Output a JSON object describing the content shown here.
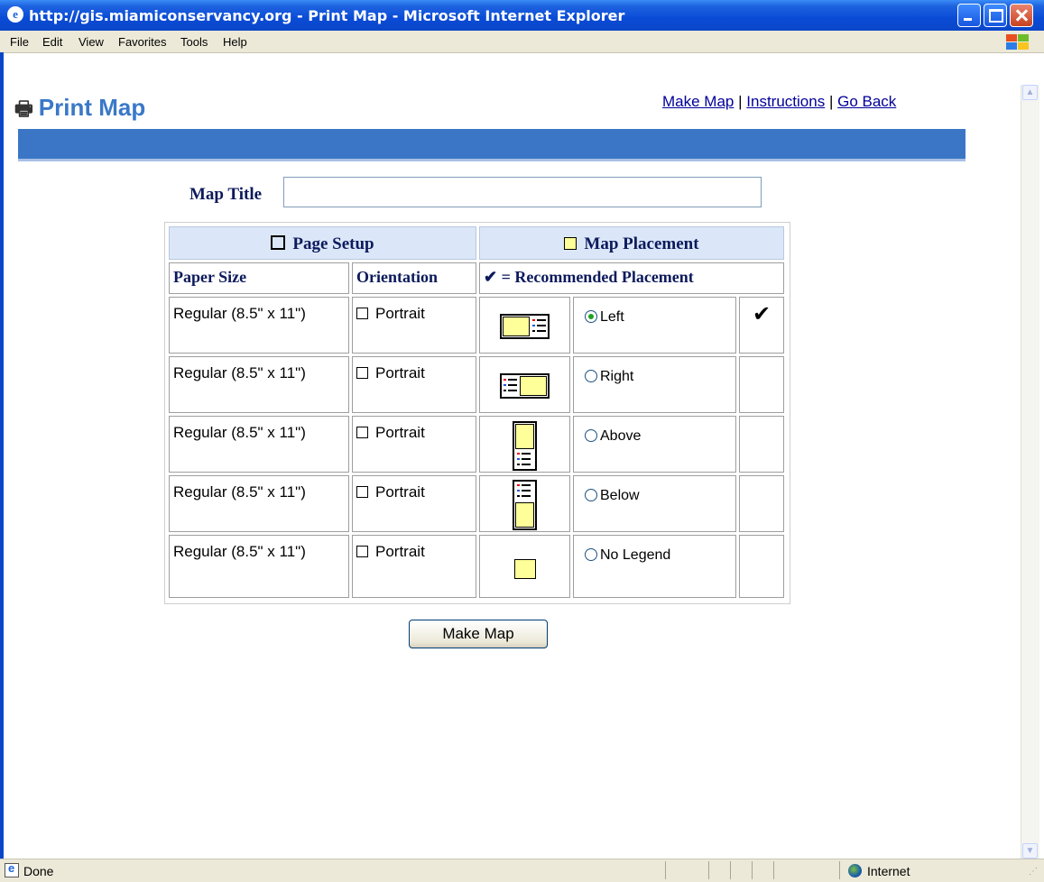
{
  "window": {
    "title": "http://gis.miamiconservancy.org - Print Map - Microsoft Internet Explorer"
  },
  "menu": [
    "File",
    "Edit",
    "View",
    "Favorites",
    "Tools",
    "Help"
  ],
  "page": {
    "title": "Print Map",
    "links": [
      "Make Map",
      "Instructions",
      "Go Back"
    ],
    "link_separator": "|"
  },
  "form": {
    "map_title_label": "Map Title",
    "map_title_value": "",
    "page_setup_header": "Page Setup",
    "map_placement_header": "Map Placement",
    "col_paper_size": "Paper Size",
    "col_orientation": "Orientation",
    "recommended_label": "= Recommended Placement",
    "rows": [
      {
        "paper": "Regular (8.5\" x 11\")",
        "orientation": "Portrait",
        "placement": "Left",
        "selected": true,
        "recommended": true
      },
      {
        "paper": "Regular (8.5\" x 11\")",
        "orientation": "Portrait",
        "placement": "Right",
        "selected": false,
        "recommended": false
      },
      {
        "paper": "Regular (8.5\" x 11\")",
        "orientation": "Portrait",
        "placement": "Above",
        "selected": false,
        "recommended": false
      },
      {
        "paper": "Regular (8.5\" x 11\")",
        "orientation": "Portrait",
        "placement": "Below",
        "selected": false,
        "recommended": false
      },
      {
        "paper": "Regular (8.5\" x 11\")",
        "orientation": "Portrait",
        "placement": "No Legend",
        "selected": false,
        "recommended": false
      }
    ],
    "submit_label": "Make Map"
  },
  "status": {
    "text": "Done",
    "zone": "Internet"
  },
  "colors": {
    "title_bar": "#0a46c8",
    "header_blue": "#3b76c6",
    "link": "#00009a",
    "map_yellow": "#ffff99"
  }
}
